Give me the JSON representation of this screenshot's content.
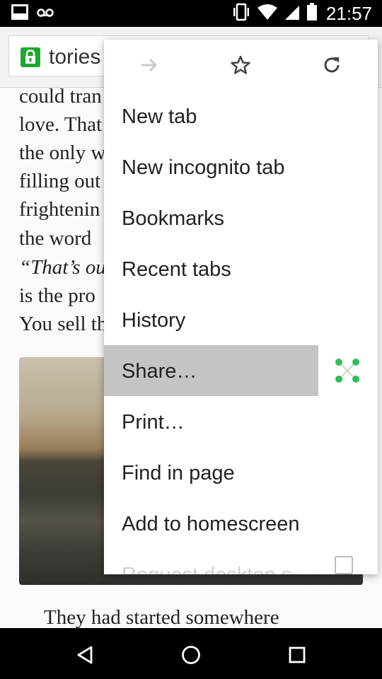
{
  "status_bar": {
    "time": "21:57",
    "icons": [
      "notification-icon",
      "voicemail-icon",
      "vibrate-icon",
      "wifi-icon",
      "signal-icon",
      "battery-icon"
    ]
  },
  "toolbar": {
    "url_text": "tories"
  },
  "article": {
    "lines": [
      "could tran",
      "love. That",
      "the only w",
      "filling out",
      "frightenin",
      "the word ",
      "“That’s ou",
      "is the pro",
      "You sell th"
    ],
    "tail_text": "They had started somewhere"
  },
  "menu": {
    "top_icons": [
      "forward-arrow-icon",
      "star-icon",
      "refresh-icon"
    ],
    "items": [
      {
        "label": "New tab"
      },
      {
        "label": "New incognito tab"
      },
      {
        "label": "Bookmarks"
      },
      {
        "label": "Recent tabs"
      },
      {
        "label": "History"
      },
      {
        "label": "Share…"
      },
      {
        "label": "Print…"
      },
      {
        "label": "Find in page"
      },
      {
        "label": "Add to homescreen"
      },
      {
        "label": "Request desktop s"
      }
    ],
    "highlighted_item": "Share…"
  },
  "colors": {
    "lock_green": "#1fa82f",
    "share_green": "#2ebd5a",
    "highlight_gray": "#c4c4c4"
  },
  "nav_bar": {
    "icons": [
      "back-icon",
      "home-icon",
      "recents-icon"
    ]
  }
}
